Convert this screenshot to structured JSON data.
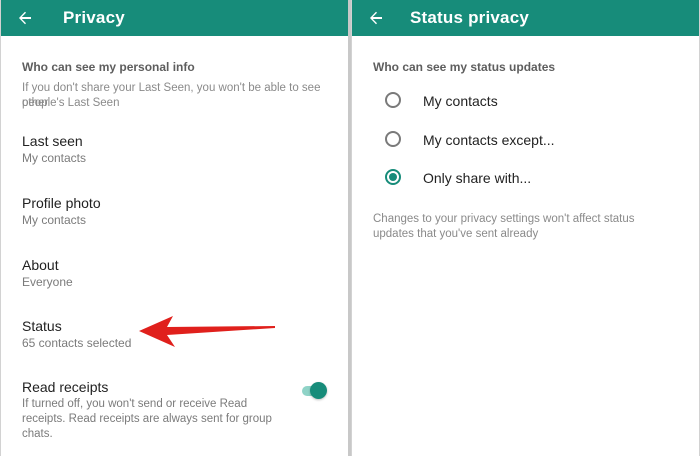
{
  "left": {
    "title": "Privacy",
    "section_header": "Who can see my personal info",
    "note_line1": "If you don't share your Last Seen, you won't be able to see other",
    "note_line2": "people's Last Seen",
    "rows": [
      {
        "title": "Last seen",
        "sub": "My contacts"
      },
      {
        "title": "Profile photo",
        "sub": "My contacts"
      },
      {
        "title": "About",
        "sub": "Everyone"
      },
      {
        "title": "Status",
        "sub": "65 contacts selected"
      }
    ],
    "read_receipts": {
      "title": "Read receipts",
      "line1": "If turned off, you won't send or receive Read",
      "line2": "receipts. Read receipts are always sent for group",
      "line3": "chats.",
      "enabled": true
    }
  },
  "right": {
    "title": "Status privacy",
    "section_header": "Who can see my status updates",
    "options": [
      {
        "label": "My contacts",
        "selected": false
      },
      {
        "label": "My contacts except...",
        "selected": false
      },
      {
        "label": "Only share with...",
        "selected": true
      }
    ],
    "note_line1": "Changes to your privacy settings won't affect status",
    "note_line2": "updates that you've sent already"
  },
  "colors": {
    "accent": "#178c7a",
    "annotation_arrow": "#e0201c"
  },
  "icons": {
    "back": "arrow-left-icon",
    "annotation": "red-arrow-pointer"
  }
}
